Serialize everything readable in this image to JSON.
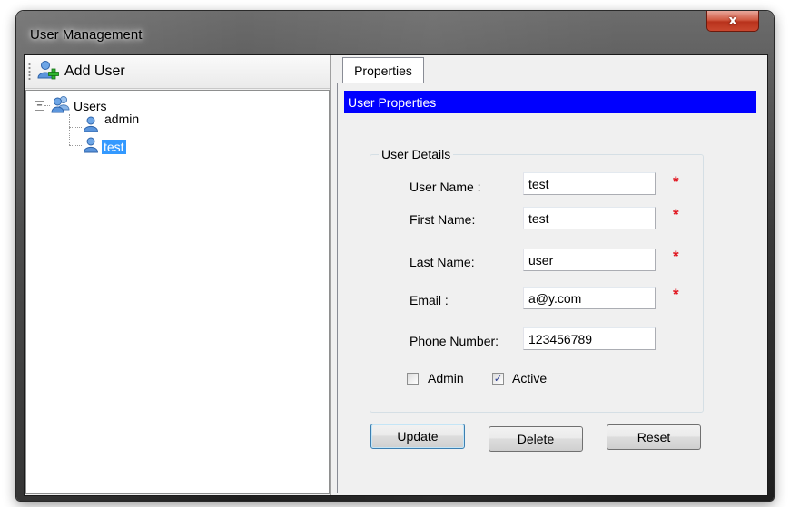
{
  "window": {
    "title": "User Management",
    "close_label": "x"
  },
  "toolbar": {
    "add_user_label": "Add User"
  },
  "tree": {
    "root": {
      "label": "Users",
      "expander": "−"
    },
    "children": [
      {
        "label": "admin",
        "selected": false
      },
      {
        "label": "test",
        "selected": true
      }
    ]
  },
  "tabs": [
    {
      "label": "Properties",
      "active": true
    }
  ],
  "properties": {
    "header": "User Properties",
    "group_title": "User Details",
    "fields": [
      {
        "label": "User Name :",
        "value": "test",
        "required": true
      },
      {
        "label": "First Name:",
        "value": "test",
        "required": true
      },
      {
        "label": "Last Name:",
        "value": "user",
        "required": true
      },
      {
        "label": "Email :",
        "value": "a@y.com",
        "required": true
      },
      {
        "label": "Phone Number:",
        "value": "123456789",
        "required": false
      }
    ],
    "required_marker": "*",
    "checkboxes": [
      {
        "label": "Admin",
        "checked": false
      },
      {
        "label": "Active",
        "checked": true
      }
    ],
    "check_glyph": "✓",
    "buttons": {
      "update": "Update",
      "delete": "Delete",
      "reset": "Reset"
    }
  },
  "colors": {
    "header_bar": "#0000ff",
    "selection": "#3399ff",
    "required": "#e0141e",
    "close_button": "#c9472f"
  }
}
